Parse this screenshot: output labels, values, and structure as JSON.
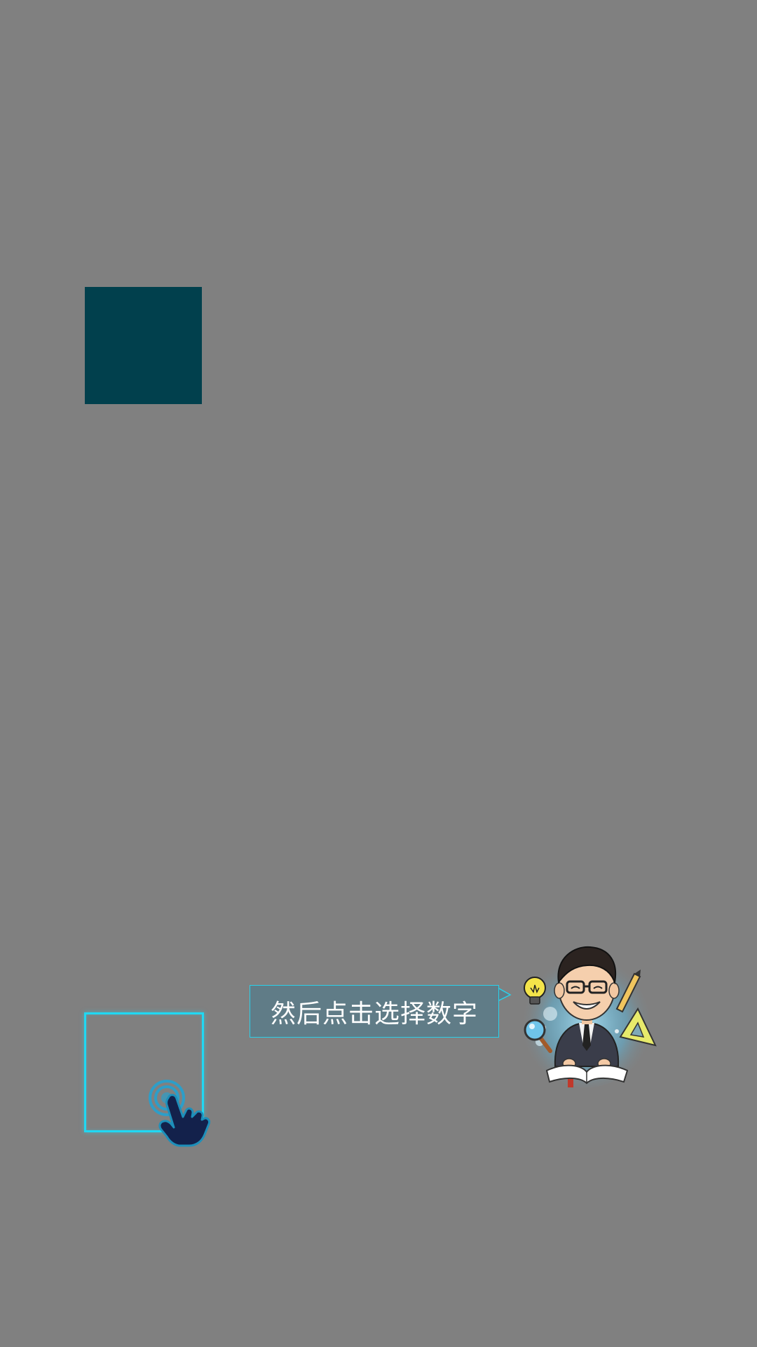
{
  "tutorial": {
    "instruction_text": "然后点击选择数字"
  },
  "colors": {
    "background": "#808080",
    "tile": "#01404d",
    "highlight": "#20d8f3",
    "bubble": "#607c87"
  },
  "icons": {
    "hand": "tap-hand-icon",
    "character": "teacher-mascot"
  }
}
